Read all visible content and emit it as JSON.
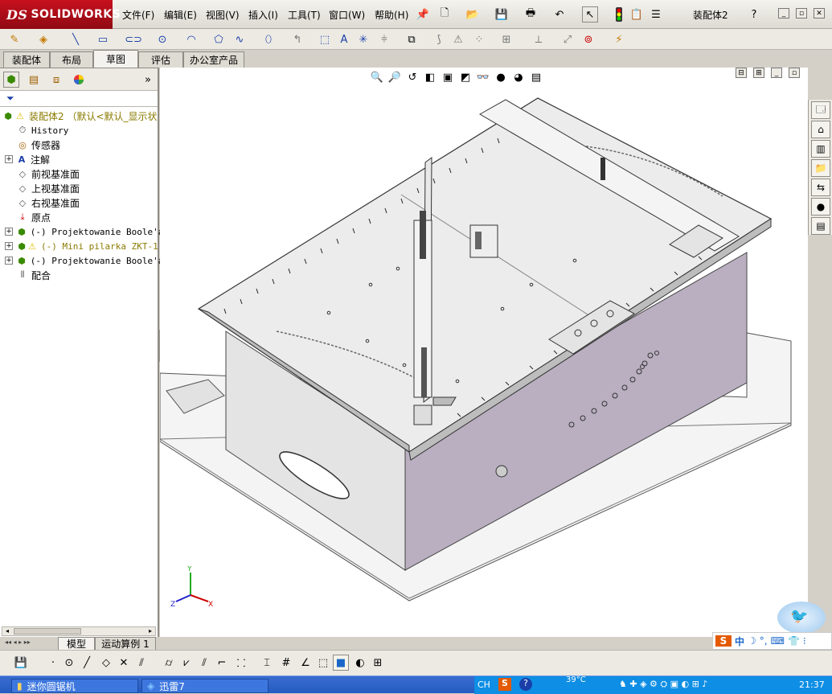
{
  "window": {
    "logo_text": "SOLIDWORKS",
    "logo_prefix": "DS",
    "document_title": "装配体2"
  },
  "menu": [
    "文件(F)",
    "编辑(E)",
    "视图(V)",
    "插入(I)",
    "工具(T)",
    "窗口(W)",
    "帮助(H)"
  ],
  "command_tabs": [
    "装配体",
    "布局",
    "草图",
    "评估",
    "办公室产品"
  ],
  "active_tab": "草图",
  "feature_tree": {
    "root": "装配体2 （默认<默认_显示状",
    "items": [
      {
        "label": "History",
        "icon": "history-icon",
        "expand": false
      },
      {
        "label": "传感器",
        "icon": "sensor-icon",
        "expand": false
      },
      {
        "label": "注解",
        "icon": "annotation-icon",
        "expand": true
      },
      {
        "label": "前视基准面",
        "icon": "plane-icon",
        "expand": false
      },
      {
        "label": "上视基准面",
        "icon": "plane-icon",
        "expand": false
      },
      {
        "label": "右视基准面",
        "icon": "plane-icon",
        "expand": false
      },
      {
        "label": "原点",
        "icon": "origin-icon",
        "expand": false
      },
      {
        "label": "(-) Projektowanie Boole'a",
        "icon": "part-icon",
        "expand": true
      },
      {
        "label": "(-) Mini pilarka ZKT-1",
        "icon": "part-warning-icon",
        "expand": true,
        "warning": true
      },
      {
        "label": "(-) Projektowanie Boole'a",
        "icon": "part-icon",
        "expand": true
      },
      {
        "label": "配合",
        "icon": "mates-icon",
        "expand": false
      }
    ]
  },
  "bottom_tabs": [
    "模型",
    "运动算例 1"
  ],
  "triad": {
    "x": "X",
    "y": "Y",
    "z": "Z"
  },
  "taskbar": {
    "tasks": [
      "迷你圆锯机",
      "迅雷7"
    ],
    "tray_lang": "CH",
    "tray_temp": "39°C",
    "clock": "21:37"
  },
  "ime": {
    "chars": "中"
  },
  "colors": {
    "brand_red": "#c8101e",
    "taskbar_blue": "#245bc0",
    "housing_purple": "#b9afc0",
    "warning_yellow": "#e5c000"
  }
}
